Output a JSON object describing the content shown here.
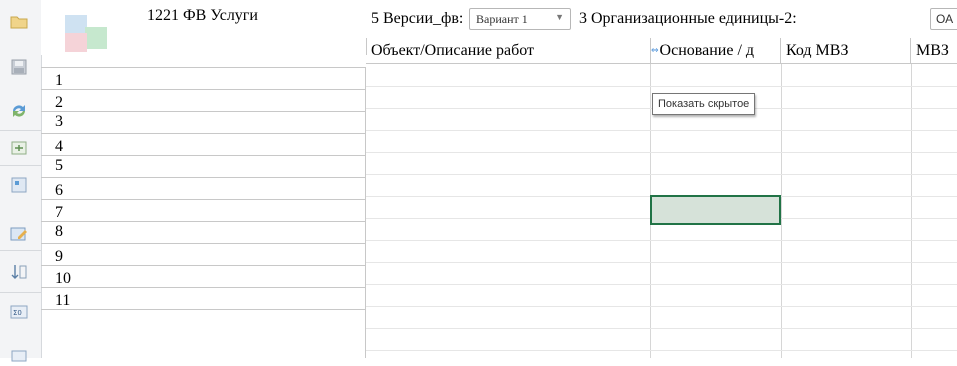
{
  "header": {
    "report_title": "1221 ФВ Услуги"
  },
  "params": {
    "p1_label": "5 Версии_фв:",
    "p1_value": "Вариант 1",
    "p1_arrow": "▼",
    "p2_label": "3 Организационные единицы-2:",
    "p2_value": "ОА"
  },
  "columns": [
    "Объект/Описание работ",
    "Основание / д",
    "Код МВЗ",
    "МВЗ"
  ],
  "rows": [
    "1",
    "2",
    "3",
    "4",
    "5",
    "6",
    "7",
    "8",
    "9",
    "10",
    "11"
  ],
  "tooltip": {
    "text": "Показать скрытое"
  },
  "toolbar": {
    "icons": [
      "open-folder-icon",
      "save-icon",
      "refresh-icon",
      "export-icon",
      "form-icon",
      "edit-icon",
      "sort-icon",
      "sum-icon"
    ]
  },
  "colors": {
    "selection_border": "#217346",
    "selection_fill": "#d6e2d9",
    "expand_arrow": "#4a90d9"
  }
}
